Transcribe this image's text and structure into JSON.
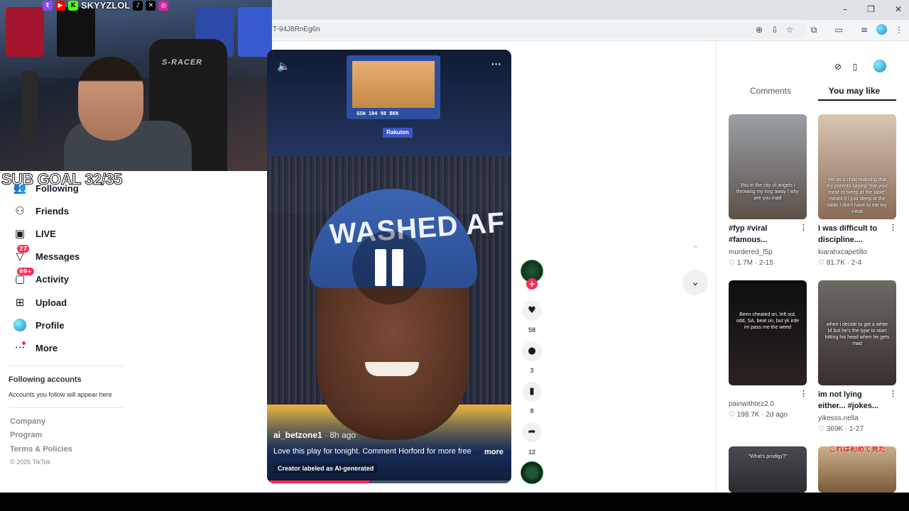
{
  "browser": {
    "url_fragment": "T-94J8RnEg6n",
    "window_controls": [
      "–",
      "❐",
      "✕"
    ]
  },
  "stream_overlay": {
    "handle": "SKYYZLOL",
    "chair_brand": "S-RACER",
    "sub_goal": "SUB GOAL 32/35",
    "social_icons": [
      "twitch-icon",
      "youtube-icon",
      "kick-icon",
      "tiktok-icon",
      "x-icon",
      "instagram-icon"
    ]
  },
  "sidebar": {
    "items": [
      {
        "label": "Following",
        "icon": "following-icon"
      },
      {
        "label": "Friends",
        "icon": "friends-icon"
      },
      {
        "label": "LIVE",
        "icon": "live-icon"
      },
      {
        "label": "Messages",
        "icon": "messages-icon",
        "badge": "27"
      },
      {
        "label": "Activity",
        "icon": "activity-icon",
        "badge": "99+"
      },
      {
        "label": "Upload",
        "icon": "upload-icon"
      },
      {
        "label": "Profile",
        "icon": "profile-icon"
      },
      {
        "label": "More",
        "icon": "more-icon"
      }
    ],
    "following_accounts_title": "Following accounts",
    "following_accounts_sub": "Accounts you follow will appear here",
    "footer_links": [
      "Company",
      "Program",
      "Terms & Policies"
    ],
    "copyright": "© 2026 TikTok"
  },
  "video": {
    "bandana_text": "WASHED AF",
    "arena_sponsor": "Rakuten",
    "scoreboard": "GSW 104   98 BKN",
    "author": "ai_betzone1",
    "time_ago": " · 8h ago",
    "caption": "Love this play for tonight. Comment Horford for more free",
    "more_label": "more",
    "ai_label": "Creator labeled as AI-generated",
    "progress": 0.42
  },
  "actions": {
    "likes": "58",
    "comments": "3",
    "saves": "8",
    "shares": "12"
  },
  "right_panel": {
    "tabs": [
      "Comments",
      "You may like"
    ],
    "active_tab": "You may like",
    "cards": [
      {
        "title": "#fyp #viral #famous...",
        "author": "murdered_l5p",
        "likes": "1.7M",
        "date": "2-15",
        "thumb_text": "You in the city of angels / throwing my ring away / why are you mad"
      },
      {
        "title": "I was difficult to discipline....",
        "author": "kiarahxcapetillo",
        "likes": "81.7K",
        "date": "2-4",
        "thumb_text": "me as a child realizing that my parents saying \"eat your meat or sleep at the table\" meant if i just sleep at the table I don't have to eat my meat"
      },
      {
        "title": "",
        "author": "painwithtez2.0",
        "likes": "198.7K",
        "date": "2d ago",
        "thumb_text": "Been cheated on, left out, odd, SA, beat on, but yk irde im pass me the weed"
      },
      {
        "title": "im not lying either... #jokes...",
        "author": "yikesss.nella",
        "likes": "369K",
        "date": "1-27",
        "thumb_text": "when i decide to get a white bf but he's the type to start hitting his head when he gets mad"
      },
      {
        "title": "",
        "author": "",
        "likes": "",
        "date": "",
        "thumb_text": "\"What's prodigy?\""
      },
      {
        "title": "",
        "author": "",
        "likes": "",
        "date": "",
        "thumb_text": "これは初めて見た"
      }
    ]
  }
}
